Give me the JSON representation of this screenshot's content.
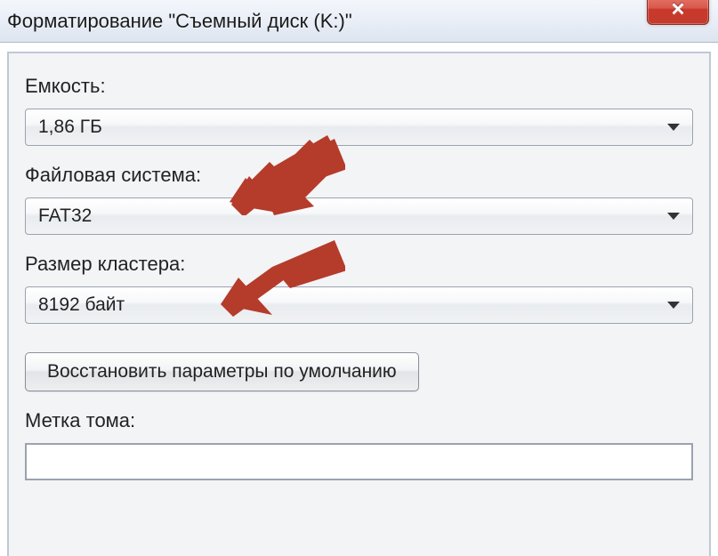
{
  "window": {
    "title": "Форматирование \"Съемный диск (K:)\""
  },
  "capacity": {
    "label": "Емкость:",
    "value": "1,86 ГБ"
  },
  "filesystem": {
    "label": "Файловая система:",
    "value": "FAT32"
  },
  "cluster": {
    "label": "Размер кластера:",
    "value": "8192 байт"
  },
  "restore_button": {
    "label": "Восстановить параметры по умолчанию"
  },
  "volume_label": {
    "label": "Метка тома:",
    "value": ""
  }
}
